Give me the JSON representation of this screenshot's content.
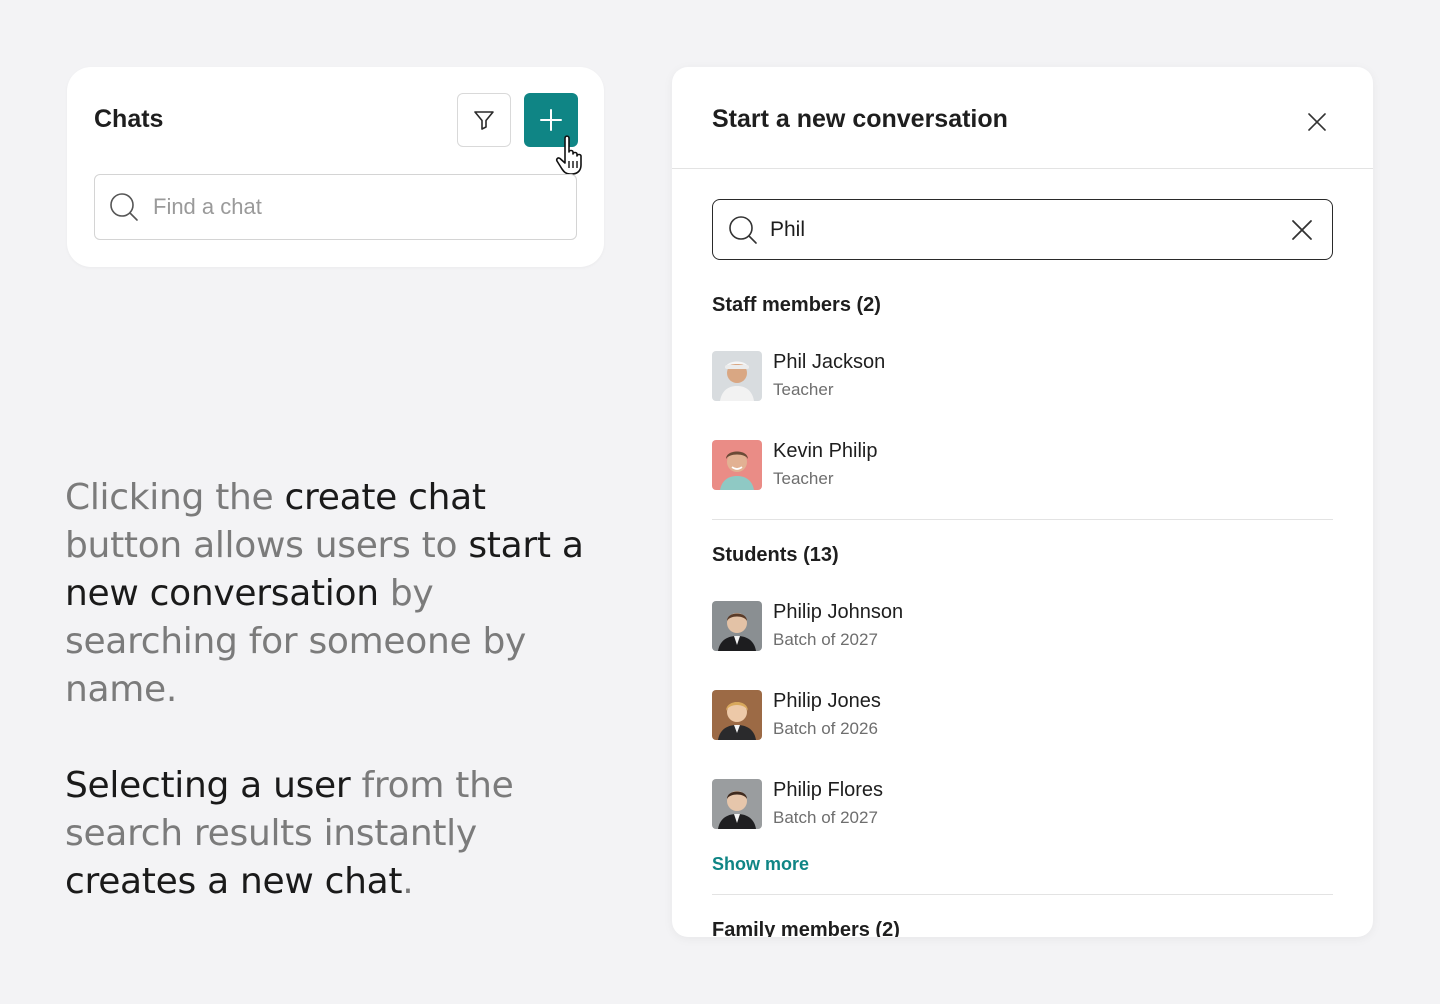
{
  "chats_panel": {
    "title": "Chats",
    "find_placeholder": "Find a chat"
  },
  "description": {
    "paragraph1": [
      {
        "text": "Clicking the ",
        "highlight": false
      },
      {
        "text": "create chat",
        "highlight": true
      },
      {
        "text": " button allows users to ",
        "highlight": false
      },
      {
        "text": "start a new conversation",
        "highlight": true
      },
      {
        "text": " by searching for someone by name.",
        "highlight": false
      }
    ],
    "paragraph2": [
      {
        "text": "Selecting a user",
        "highlight": true
      },
      {
        "text": " from the search results instantly ",
        "highlight": false
      },
      {
        "text": "creates a new chat",
        "highlight": true
      },
      {
        "text": ".",
        "highlight": false
      }
    ]
  },
  "modal": {
    "title": "Start a new conversation",
    "search_value": "Phil",
    "staff_label": "Staff members (2)",
    "staff": [
      {
        "name": "Phil Jackson",
        "role": "Teacher"
      },
      {
        "name": "Kevin Philip",
        "role": "Teacher"
      }
    ],
    "students_label": "Students (13)",
    "students": [
      {
        "name": "Philip Johnson",
        "batch": "Batch of 2027"
      },
      {
        "name": "Philip Jones",
        "batch": "Batch of 2026"
      },
      {
        "name": "Philip Flores",
        "batch": "Batch of 2027"
      }
    ],
    "show_more": "Show more",
    "family_label": "Family members (2)"
  },
  "colors": {
    "accent": "#0f8585",
    "background": "#f3f3f5",
    "text_muted": "#7b7b7b"
  },
  "icons": [
    "filter-icon",
    "plus-icon",
    "hand-pointer-icon",
    "search-icon",
    "close-icon",
    "clear-icon"
  ]
}
